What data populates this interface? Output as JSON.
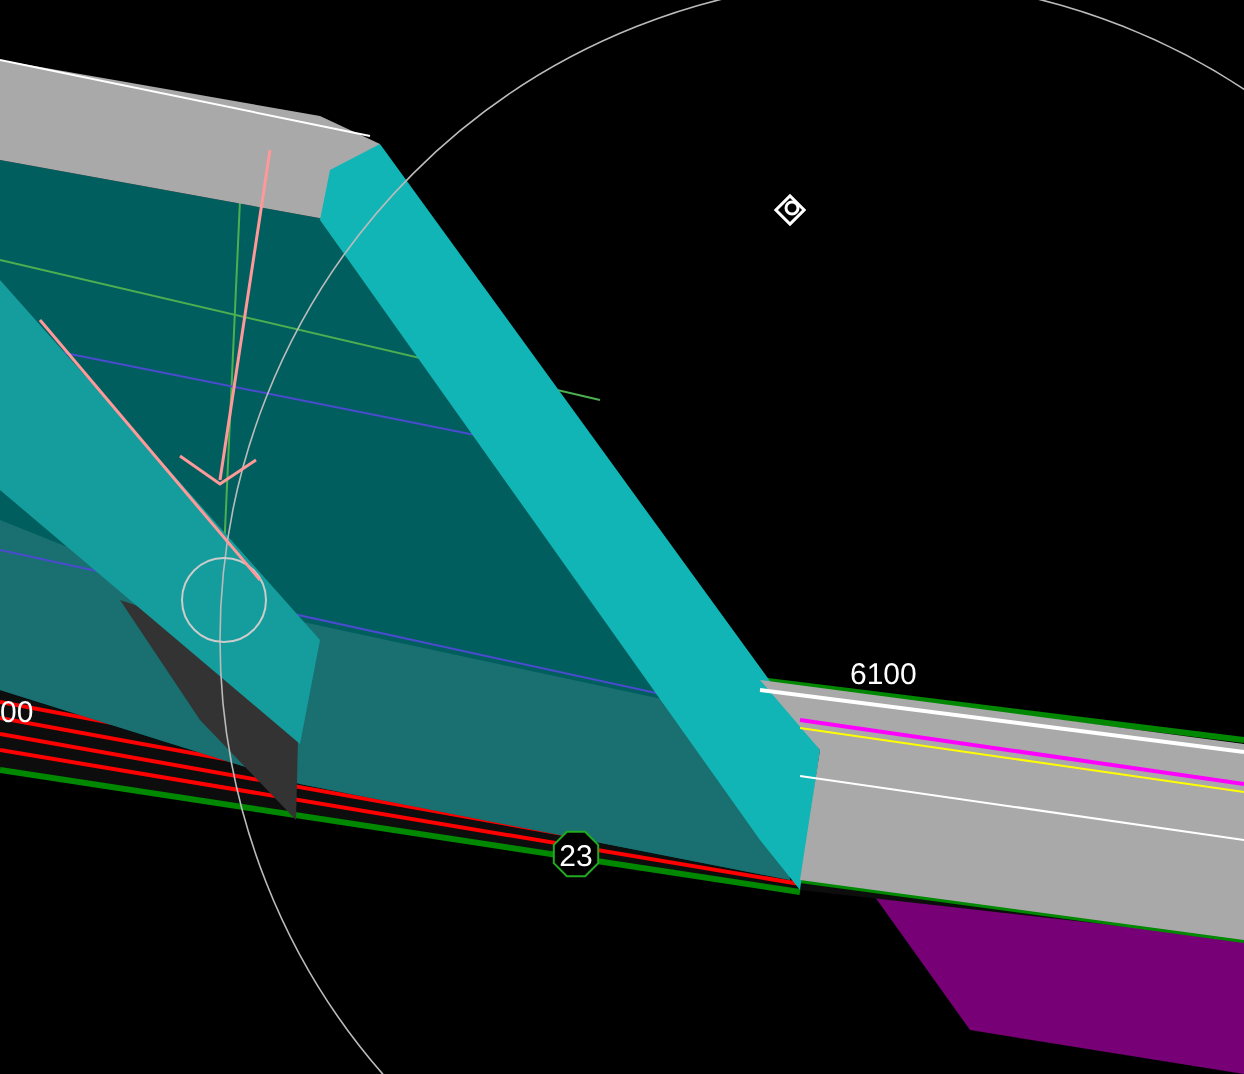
{
  "viewport": {
    "labels": [
      {
        "kind": "dimension",
        "text": "6100"
      },
      {
        "kind": "dimension",
        "text": "00"
      },
      {
        "kind": "grid_bubble",
        "text": "23"
      }
    ]
  }
}
